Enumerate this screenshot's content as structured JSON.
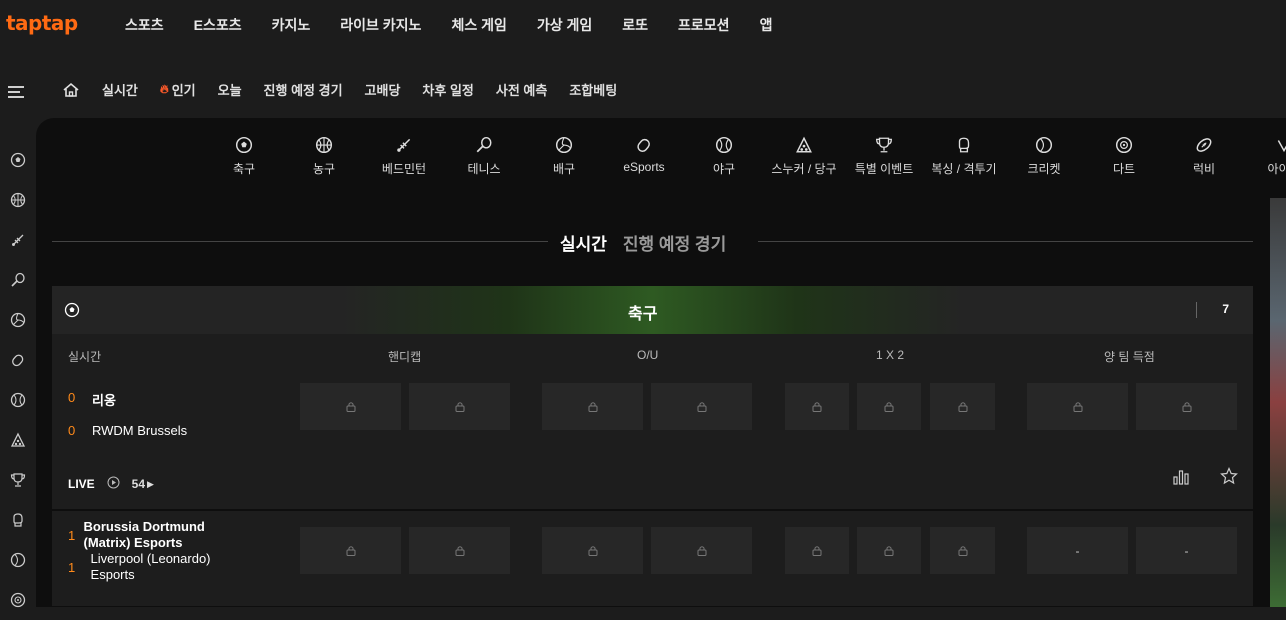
{
  "brand": "taptap",
  "topnav": [
    "스포츠",
    "E스포츠",
    "카지노",
    "라이브 카지노",
    "체스 게임",
    "가상 게임",
    "로또",
    "프로모션",
    "앱"
  ],
  "subnav": {
    "items": [
      "실시간",
      "인기",
      "오늘",
      "진행 예정 경기",
      "고배당",
      "차후 일정",
      "사전 예측",
      "조합베팅"
    ]
  },
  "sports": [
    {
      "label": "축구",
      "icon": "soccer-icon"
    },
    {
      "label": "농구",
      "icon": "basketball-icon"
    },
    {
      "label": "베드민턴",
      "icon": "badminton-icon"
    },
    {
      "label": "테니스",
      "icon": "tennis-icon"
    },
    {
      "label": "배구",
      "icon": "volleyball-icon"
    },
    {
      "label": "eSports",
      "icon": "mouse-icon"
    },
    {
      "label": "야구",
      "icon": "baseball-icon"
    },
    {
      "label": "스누커 / 당구",
      "icon": "snooker-icon"
    },
    {
      "label": "특별 이벤트",
      "icon": "trophy-icon"
    },
    {
      "label": "복싱 / 격투기",
      "icon": "boxing-icon"
    },
    {
      "label": "크리켓",
      "icon": "cricket-icon"
    },
    {
      "label": "다트",
      "icon": "darts-icon"
    },
    {
      "label": "럭비",
      "icon": "rugby-icon"
    },
    {
      "label": "아이스",
      "icon": "ice-icon"
    }
  ],
  "tabs": {
    "active": "실시간",
    "inactive": "진행 예정 경기"
  },
  "section": {
    "title": "축구",
    "count": "7",
    "headers": {
      "live": "실시간",
      "handicap": "핸디캡",
      "ou": "O/U",
      "x12": "1 X 2",
      "both": "양 팀 득점"
    }
  },
  "matches": [
    {
      "home": {
        "score": "0",
        "name": "리옹"
      },
      "away": {
        "score": "0",
        "name": "RWDM Brussels"
      },
      "status": "LIVE",
      "markets_count": "54"
    },
    {
      "home": {
        "score": "1",
        "name": "Borussia Dortmund (Matrix) Esports"
      },
      "away": {
        "score": "1",
        "name": "Liverpool (Leonardo) Esports"
      },
      "both_a": "-",
      "both_b": "-"
    }
  ],
  "colors": {
    "brand": "#ff6a13",
    "score": "#ff8a1a",
    "background": "#0e0e0e",
    "panel": "#1d1d1d",
    "cell": "#272727"
  }
}
